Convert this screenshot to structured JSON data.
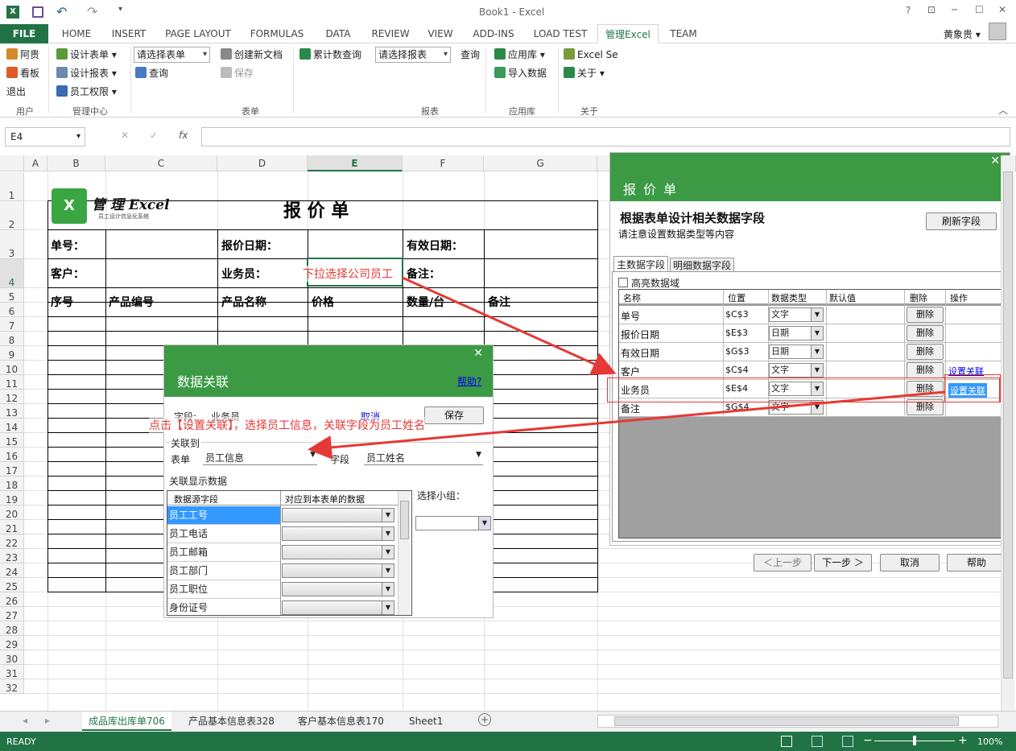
{
  "window": {
    "title": "Book1 - Excel",
    "help": "?",
    "minimize": "─",
    "restore": "☐",
    "close": "✕",
    "ribbon_opts": "⊡"
  },
  "ribbon_tabs": [
    "FILE",
    "HOME",
    "INSERT",
    "PAGE LAYOUT",
    "FORMULAS",
    "DATA",
    "REVIEW",
    "VIEW",
    "ADD-INS",
    "LOAD TEST",
    "管理Excel",
    "TEAM"
  ],
  "user": {
    "name": "黄象贵 ▾"
  },
  "ribbon": {
    "user_group": {
      "items": [
        "阿贵",
        "看板",
        "退出"
      ],
      "label": "用户"
    },
    "mgmt_group": {
      "items": [
        "设计表单",
        "设计报表",
        "员工权限"
      ],
      "label": "管理中心"
    },
    "form_group": {
      "select_form": "请选择表单",
      "query": "查询",
      "create_doc": "创建新文档",
      "save": "保存",
      "label": "表单"
    },
    "report_group": {
      "accum_query": "累计数查询",
      "select_report": "请选择报表",
      "query": "查询",
      "label": "报表"
    },
    "app_group": {
      "app_store": "应用库",
      "import": "导入数据",
      "label": "应用库"
    },
    "about_group": {
      "excel_se": "Excel Se",
      "about": "关于",
      "label": "关于"
    }
  },
  "formula_bar": {
    "name_box": "E4",
    "cancel": "✕",
    "enter": "✓",
    "fx": "fx",
    "value": ""
  },
  "columns": [
    "A",
    "B",
    "C",
    "D",
    "E",
    "F",
    "G"
  ],
  "rows": [
    "1",
    "2",
    "3",
    "4",
    "5",
    "6",
    "7",
    "8",
    "9",
    "10",
    "11",
    "12",
    "13",
    "14",
    "15",
    "16",
    "17",
    "18",
    "19",
    "20",
    "21",
    "22",
    "23",
    "24",
    "25",
    "26",
    "27",
    "28",
    "29",
    "30",
    "31",
    "32"
  ],
  "sheet": {
    "logo_text": "管 理 Excel",
    "logo_sub": "员工设计信息化系统",
    "title": "报 价 单",
    "labels": {
      "order_no": "单号：",
      "quote_date": "报价日期：",
      "valid_date": "有效日期：",
      "customer": "客户：",
      "salesman": "业务员：",
      "remark": "备注："
    },
    "headers": [
      "序号",
      "产品编号",
      "产品名称",
      "价格",
      "数量/台",
      "备注"
    ],
    "annotation1": "下拉选择公司员工"
  },
  "right_panel": {
    "title": "报 价 单",
    "heading": "根据表单设计相关数据字段",
    "subheading": "请注意设置数据类型等内容",
    "refresh": "刷新字段",
    "tabs": [
      "主数据字段",
      "明细数据字段"
    ],
    "highlight": "高亮数据域",
    "cols": [
      "名称",
      "位置",
      "数据类型",
      "默认值",
      "删除",
      "操作"
    ],
    "rows": [
      {
        "name": "单号",
        "pos": "$C$3",
        "type": "文字",
        "del": "删除",
        "op": ""
      },
      {
        "name": "报价日期",
        "pos": "$E$3",
        "type": "日期",
        "del": "删除",
        "op": ""
      },
      {
        "name": "有效日期",
        "pos": "$G$3",
        "type": "日期",
        "del": "删除",
        "op": ""
      },
      {
        "name": "客户",
        "pos": "$C$4",
        "type": "文字",
        "del": "删除",
        "op": "设置关联"
      },
      {
        "name": "业务员",
        "pos": "$E$4",
        "type": "文字",
        "del": "删除",
        "op": "设置关联"
      },
      {
        "name": "备注",
        "pos": "$G$4",
        "type": "文字",
        "del": "删除",
        "op": ""
      }
    ],
    "prev": "＜上一步",
    "next": "下一步 ＞",
    "cancel": "取消",
    "help": "帮助"
  },
  "dialog": {
    "title": "数据关联",
    "help": "帮助?",
    "field_label": "字段:",
    "field_value": "业务员",
    "cancel": "取消",
    "save": "保存",
    "assoc_to": "关联到",
    "form_label": "表单",
    "form_value": "员工信息",
    "field2_label": "字段",
    "field2_value": "员工姓名",
    "display_group": "关联显示数据",
    "cols": [
      "数据源字段",
      "对应到本表单的数据"
    ],
    "rows": [
      "员工工号",
      "员工电话",
      "员工邮箱",
      "员工部门",
      "员工职位",
      "身份证号"
    ],
    "select_group": "选择小组："
  },
  "annotation2": "点击【设置关联】，选择员工信息，关联字段为员工姓名",
  "sheet_tabs": [
    "成品库出库单706",
    "产品基本信息表328",
    "客户基本信息表170",
    "Sheet1"
  ],
  "status": {
    "ready": "READY",
    "zoom": "100%"
  },
  "colors": {
    "excel_green": "#217346",
    "panel_green": "#3c9a45",
    "annotation_red": "#e53935",
    "selection_blue": "#3399ff"
  }
}
